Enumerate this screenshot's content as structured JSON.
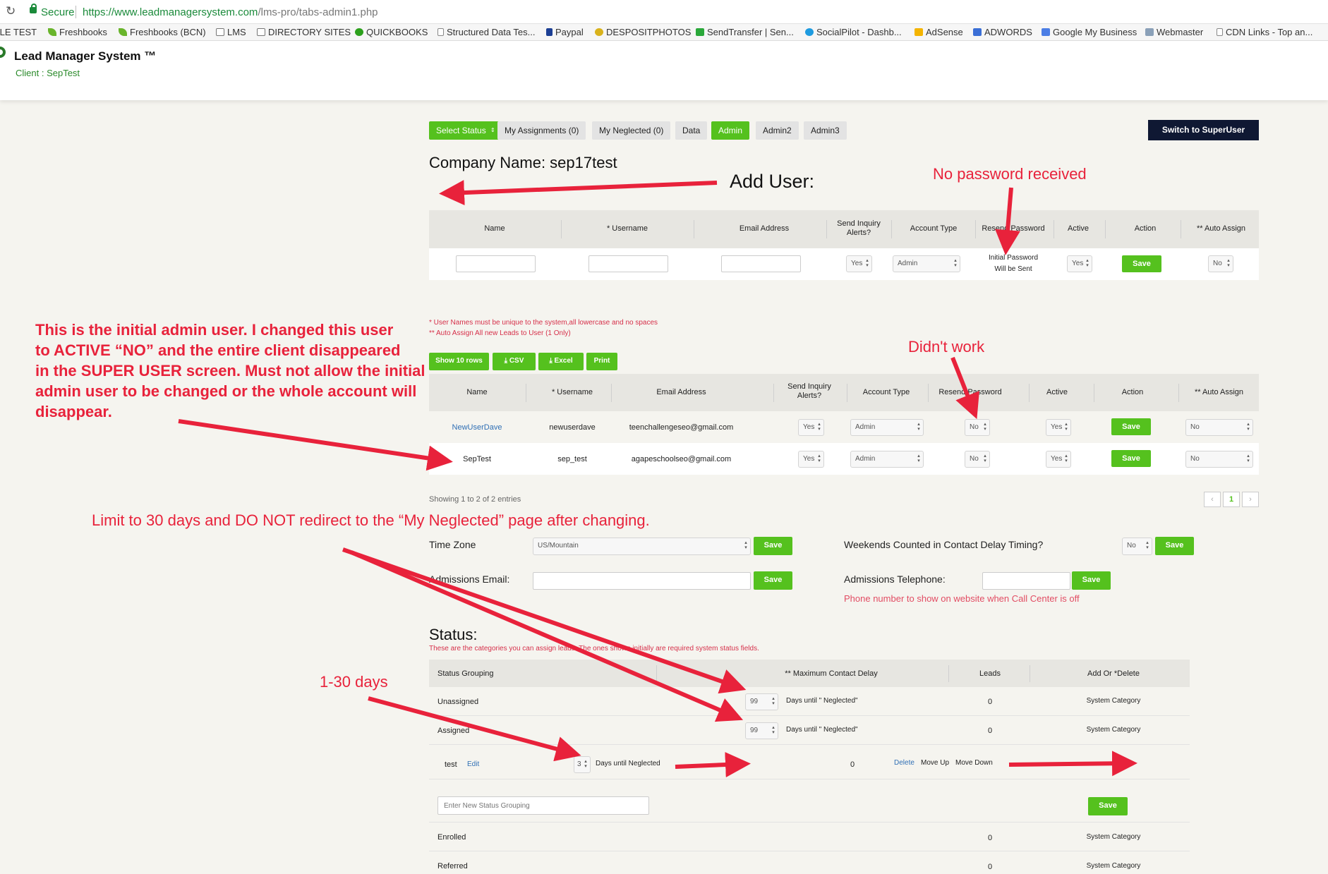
{
  "browser": {
    "secure_label": "Secure",
    "url_host": "https://www.leadmanagersystem.com",
    "url_path": "/lms-pro/tabs-admin1.php",
    "bookmarks": [
      {
        "label": "ILE TEST",
        "icon": "none"
      },
      {
        "label": "Freshbooks",
        "icon": "leaf-icon"
      },
      {
        "label": "Freshbooks (BCN)",
        "icon": "leaf-icon"
      },
      {
        "label": "LMS",
        "icon": "folder-icon"
      },
      {
        "label": "DIRECTORY SITES",
        "icon": "folder-icon"
      },
      {
        "label": "QUICKBOOKS",
        "icon": "quickbooks-icon"
      },
      {
        "label": "Structured Data Tes...",
        "icon": "page-icon"
      },
      {
        "label": "Paypal",
        "icon": "paypal-icon"
      },
      {
        "label": "DESPOSITPHOTOS",
        "icon": "depositphotos-icon"
      },
      {
        "label": "SendTransfer | Sen...",
        "icon": "sendtransfer-icon"
      },
      {
        "label": "SocialPilot - Dashb...",
        "icon": "socialpilot-icon"
      },
      {
        "label": "AdSense",
        "icon": "adsense-icon"
      },
      {
        "label": "ADWORDS",
        "icon": "adwords-icon"
      },
      {
        "label": "Google My Business",
        "icon": "gmb-icon"
      },
      {
        "label": "Webmaster",
        "icon": "webmaster-icon"
      },
      {
        "label": "CDN Links - Top an...",
        "icon": "page-icon"
      }
    ]
  },
  "app": {
    "title": "Lead Manager System ™",
    "client": "Client : SepTest"
  },
  "tabs": [
    {
      "label": "Select Status",
      "active": true,
      "dropdown": true
    },
    {
      "label": "My Assignments (0)",
      "active": false
    },
    {
      "label": "My Neglected (0)",
      "active": false
    },
    {
      "label": "Data",
      "active": false
    },
    {
      "label": "Admin",
      "active": true
    },
    {
      "label": "Admin2",
      "active": false
    },
    {
      "label": "Admin3",
      "active": false
    }
  ],
  "switch_superuser": "Switch to SuperUser",
  "company_name": "Company Name: sep17test",
  "add_user": {
    "headers": [
      "Name",
      "* Username",
      "Email Address",
      "Send Inquiry Alerts?",
      "Account Type",
      "Resend Password",
      "Active",
      "Action",
      "** Auto Assign"
    ],
    "send_alerts": "Yes",
    "account_type": "Admin",
    "initial_password_line1": "Initial Password",
    "initial_password_line2": "Will be Sent",
    "active": "Yes",
    "save": "Save",
    "auto_assign": "No"
  },
  "notes": {
    "unique": "* User Names must be unique to the system,all lowercase and no spaces",
    "auto_assign": "** Auto Assign All new Leads to User (1 Only)"
  },
  "export_buttons": {
    "show": "Show 10 rows",
    "csv": "CSV",
    "excel": "Excel",
    "print": "Print"
  },
  "users": {
    "headers": [
      "Name",
      "* Username",
      "Email Address",
      "Send Inquiry Alerts?",
      "Account Type",
      "Resend Password",
      "Active",
      "Action",
      "** Auto Assign"
    ],
    "rows": [
      {
        "name": "NewUserDave",
        "username": "newuserdave",
        "email": "teenchallengeseo@gmail.com",
        "alerts": "Yes",
        "type": "Admin",
        "resend": "No",
        "active": "Yes",
        "action": "Save",
        "auto": "No"
      },
      {
        "name": "SepTest",
        "username": "sep_test",
        "email": "agapeschoolseo@gmail.com",
        "alerts": "Yes",
        "type": "Admin",
        "resend": "No",
        "active": "Yes",
        "action": "Save",
        "auto": "No"
      }
    ],
    "showing": "Showing 1 to 2 of 2 entries",
    "page": "1",
    "prev": "‹",
    "next": "›"
  },
  "settings": {
    "timezone_label": "Time Zone",
    "timezone_value": "US/Mountain",
    "weekends_label": "Weekends Counted in Contact Delay Timing?",
    "weekends_value": "No",
    "admissions_email_label": "Admissions Email:",
    "admissions_phone_label": "Admissions Telephone:",
    "phone_note": "Phone number to show on website when Call Center is off",
    "save": "Save"
  },
  "status": {
    "title": "Status:",
    "subtitle": "These are the categories you can assign leads. The ones shown initially are required system status fields.",
    "headers": [
      "Status Grouping",
      "** Maximum Contact Delay",
      "Leads",
      "Add Or *Delete"
    ],
    "rows": [
      {
        "name": "Unassigned",
        "delay": "99",
        "delay_label": "Days until \" Neglected\"",
        "leads": "0",
        "action": "System Category"
      },
      {
        "name": "Assigned",
        "delay": "99",
        "delay_label": "Days until \" Neglected\"",
        "leads": "0",
        "action": "System Category"
      }
    ],
    "custom_row": {
      "name": "test",
      "edit": "Edit",
      "delay": "3",
      "delay_label": "Days until Neglected",
      "leads": "0",
      "delete": "Delete",
      "move_up": "Move Up",
      "move_down": "Move Down"
    },
    "new_placeholder": "Enter New Status Grouping",
    "save": "Save",
    "more_rows": [
      {
        "name": "Enrolled",
        "leads": "0",
        "action": "System Category"
      },
      {
        "name": "Referred",
        "leads": "0",
        "action": "System Category"
      }
    ]
  },
  "annotations": {
    "add_user": "Add User:",
    "no_password": "No password received",
    "didnt_work": "Didn't work",
    "initial_admin": [
      "This is the initial admin user.  I changed this user",
      "to ACTIVE “NO” and the entire client disappeared",
      "in the SUPER USER screen.  Must not allow the initial",
      "admin user to be changed or the whole account will",
      "disappear."
    ],
    "limit": "Limit to 30 days and DO NOT redirect to the “My Neglected” page after changing.",
    "days": "1-30 days"
  },
  "colors": {
    "green": "#55c11e",
    "navy": "#0f1833",
    "annotation_red": "#e8223b",
    "link_blue": "#2f6fb5"
  }
}
